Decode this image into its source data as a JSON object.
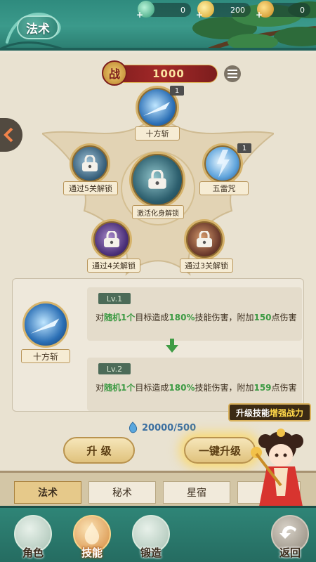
{
  "header": {
    "title": "法术",
    "resources": [
      {
        "icon": "jade-gem-icon",
        "value": "0"
      },
      {
        "icon": "gold-ingot-icon",
        "value": "200"
      },
      {
        "icon": "copper-coin-icon",
        "value": "0"
      }
    ]
  },
  "power": {
    "label": "战",
    "value": "1000"
  },
  "skill_tree": {
    "top": {
      "name": "十方斩",
      "level": "1"
    },
    "center": {
      "lock_text": "激活化身解锁"
    },
    "left": {
      "lock_text": "通过5关解锁"
    },
    "right": {
      "name": "五雷咒",
      "level": "1"
    },
    "bottom_left": {
      "lock_text": "通过4关解锁"
    },
    "bottom_right": {
      "lock_text": "通过3关解锁"
    }
  },
  "detail": {
    "skill_name": "十方斩",
    "current": {
      "level": "Lv.1",
      "desc_prefix": "对",
      "target": "随机1个",
      "desc_mid": "目标造成",
      "percent": "180%",
      "desc_mid2": "技能伤害，附加",
      "extra": "150",
      "desc_suffix": "点伤害"
    },
    "next": {
      "level": "Lv.2",
      "desc_prefix": "对",
      "target": "随机1个",
      "desc_mid": "目标造成",
      "percent": "180%",
      "desc_mid2": "技能伤害，附加",
      "extra": "159",
      "desc_suffix": "点伤害"
    }
  },
  "cost": "20000/500",
  "buttons": {
    "upgrade": "升 级",
    "one_click": "一键升级"
  },
  "tooltip": {
    "text": "升级技能",
    "highlight": "增强战力"
  },
  "tabs": [
    {
      "label": "法术",
      "active": true
    },
    {
      "label": "秘术",
      "active": false
    },
    {
      "label": "星宿",
      "active": false
    }
  ],
  "nav": [
    {
      "label": "角色",
      "icon": "character-icon"
    },
    {
      "label": "技能",
      "icon": "skill-flame-icon"
    },
    {
      "label": "锻造",
      "icon": "forge-anvil-icon"
    },
    {
      "label": "返回",
      "icon": "return-arrow-icon"
    }
  ],
  "colors": {
    "header_teal": "#2f8b7e",
    "power_red": "#a32828",
    "highlight_green": "#3c9a43",
    "panel_beige": "#e9e2d1"
  }
}
